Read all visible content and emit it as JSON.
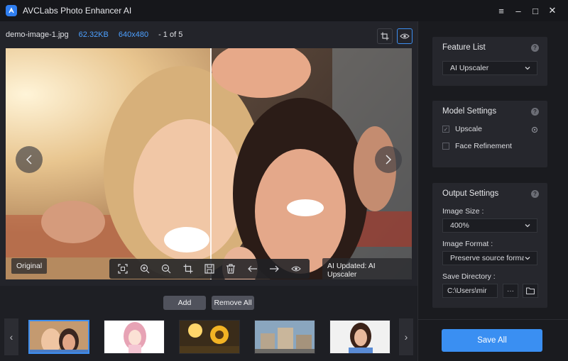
{
  "app": {
    "title": "AVCLabs Photo Enhancer AI"
  },
  "window_controls": {
    "menu": "≡",
    "minimize": "–",
    "maximize": "□",
    "close": "✕"
  },
  "file_info": {
    "name": "demo-image-1.jpg",
    "size": "62.32KB",
    "dimensions": "640x480",
    "position": "- 1 of 5"
  },
  "viewer": {
    "original_badge": "Original",
    "ai_badge": "AI Updated: AI Upscaler",
    "toolbar_icons": [
      "fit-screen-icon",
      "zoom-in-icon",
      "zoom-out-icon",
      "crop-icon",
      "save-icon",
      "delete-icon",
      "arrow-left-icon",
      "arrow-right-icon",
      "eye-icon"
    ]
  },
  "thumbnails": {
    "add_label": "Add",
    "remove_all_label": "Remove All",
    "count": 5,
    "selected_index": 0
  },
  "feature_list": {
    "title": "Feature List",
    "selected": "AI Upscaler"
  },
  "model_settings": {
    "title": "Model Settings",
    "options": [
      {
        "label": "Upscale",
        "checked": true
      },
      {
        "label": "Face Refinement",
        "checked": false
      }
    ]
  },
  "output_settings": {
    "title": "Output Settings",
    "image_size_label": "Image Size :",
    "image_size_value": "400%",
    "image_format_label": "Image Format :",
    "image_format_value": "Preserve source format",
    "save_dir_label": "Save Directory :",
    "save_dir_value": "C:\\Users\\mir",
    "more_label": "···"
  },
  "save_all_label": "Save All",
  "colors": {
    "accent": "#3a8ff2",
    "info_blue": "#4da0ff",
    "panel": "#26272d"
  }
}
